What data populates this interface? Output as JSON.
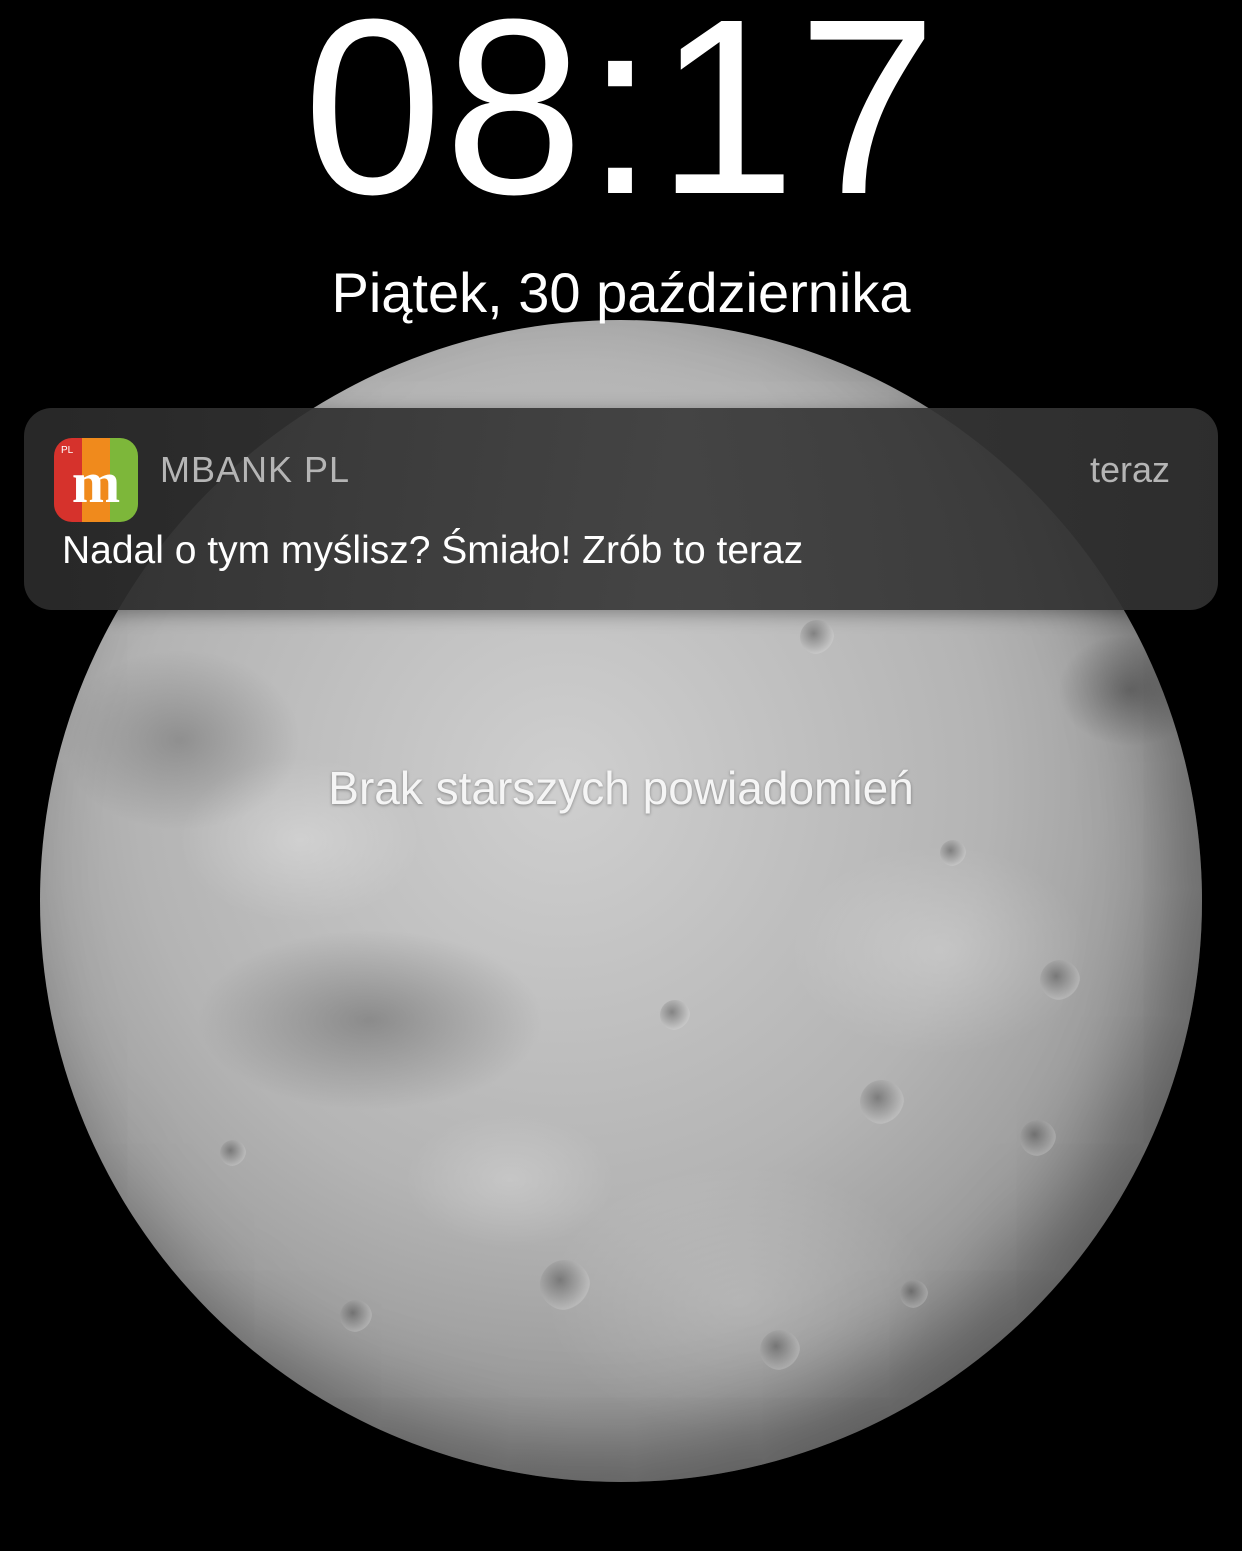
{
  "lockscreen": {
    "time": "08:17",
    "date": "Piątek, 30 października",
    "empty_state": "Brak starszych powiadomień"
  },
  "notification": {
    "app_name": "MBANK PL",
    "time": "teraz",
    "message": "Nadal o tym myślisz? Śmiało! Zrób to teraz",
    "icon": "mbank-app-icon",
    "icon_badge": "PL",
    "icon_letter": "m",
    "icon_colors": [
      "#d6322c",
      "#f08a1c",
      "#7db73a"
    ]
  },
  "wallpaper": {
    "subject": "moon-wallpaper",
    "background_color": "#000000"
  }
}
